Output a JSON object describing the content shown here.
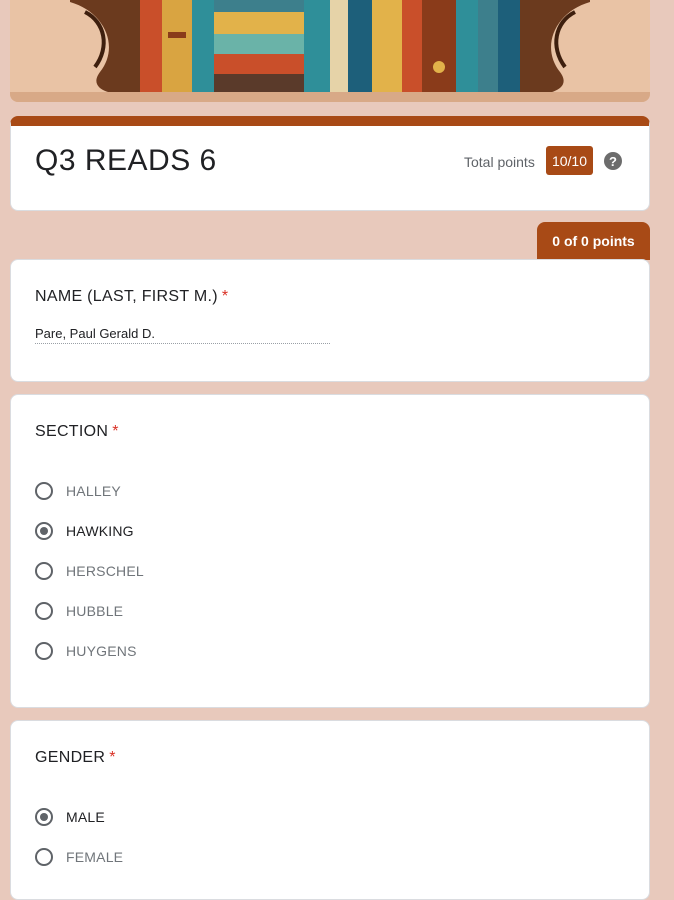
{
  "form": {
    "title": "Q3 READS 6",
    "total_points_label": "Total points",
    "score": "10/10",
    "help_glyph": "?",
    "section_points": "0 of 0 points",
    "theme_color": "#a84a16"
  },
  "questions": {
    "name": {
      "label": "NAME (LAST, FIRST M.)",
      "required_mark": "*",
      "answer": "Pare, Paul Gerald D."
    },
    "section": {
      "label": "SECTION",
      "required_mark": "*",
      "options": [
        "HALLEY",
        "HAWKING",
        "HERSCHEL",
        "HUBBLE",
        "HUYGENS"
      ],
      "selected": "HAWKING"
    },
    "gender": {
      "label": "GENDER",
      "required_mark": "*",
      "options": [
        "MALE",
        "FEMALE"
      ],
      "selected": "MALE"
    }
  }
}
